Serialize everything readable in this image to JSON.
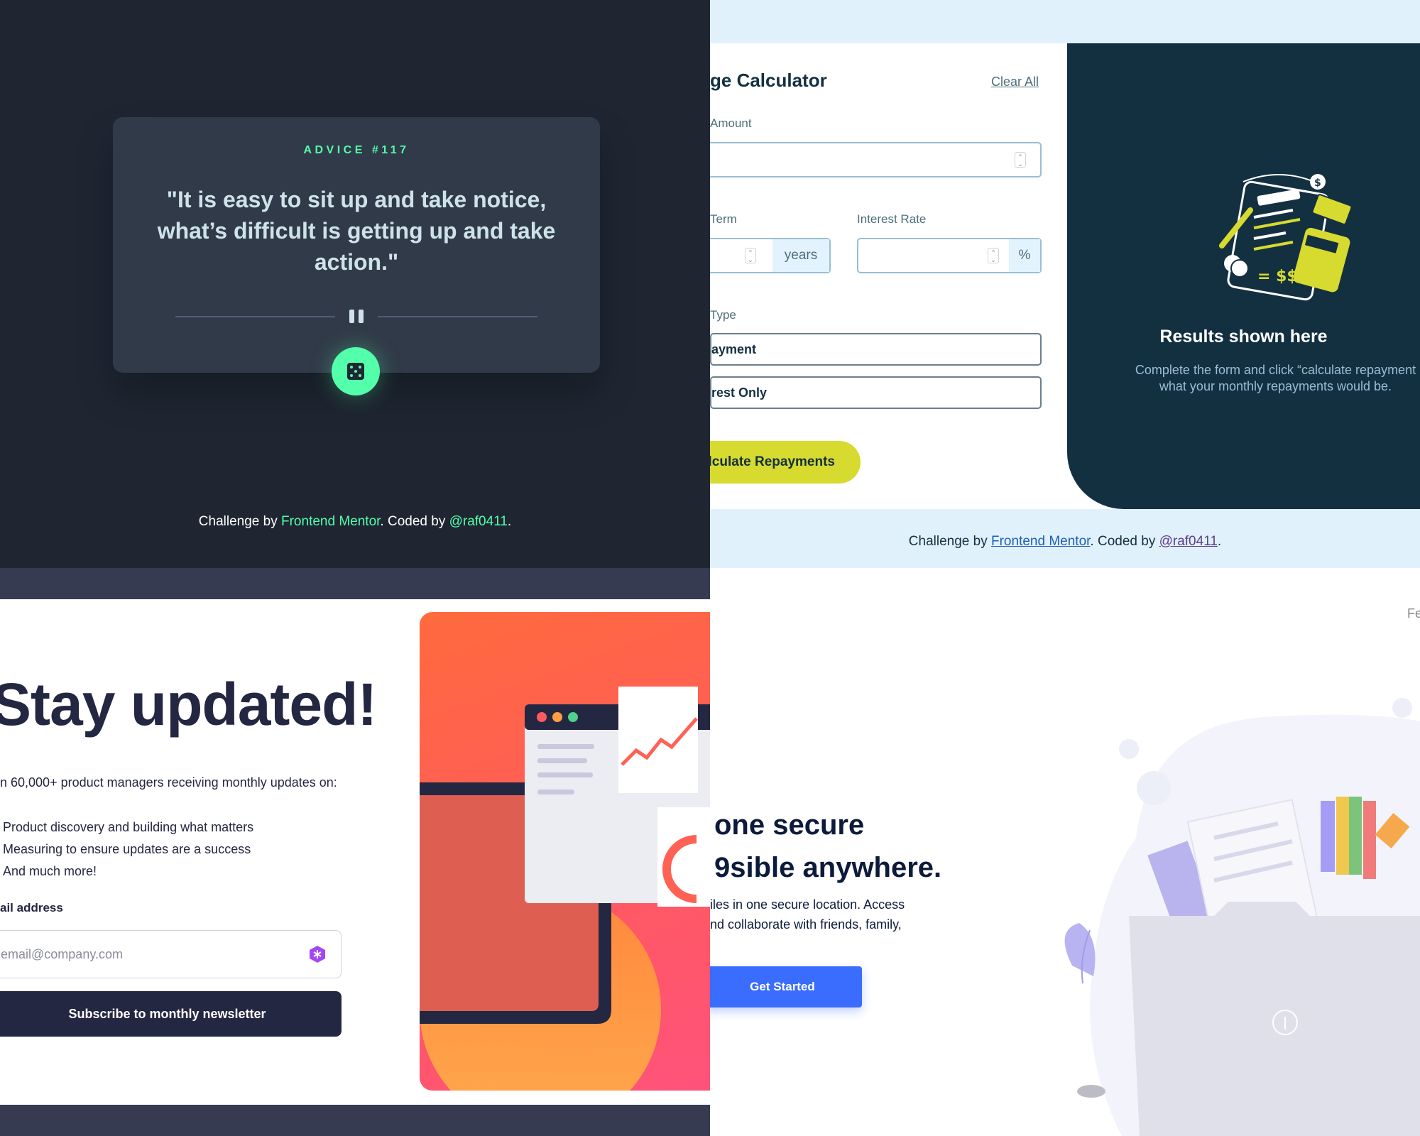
{
  "advice": {
    "id_label": "ADVICE #117",
    "quote": "\"It is easy to sit up and take notice, what’s difficult is getting up and take action.\"",
    "footer": {
      "prefix": "Challenge by ",
      "link1": "Frontend Mentor",
      "middle": ". Coded by ",
      "link2": "@raf0411",
      "suffix": "."
    },
    "colors": {
      "background": "#1f2632",
      "card": "#313a48",
      "accent": "#53ffaa"
    }
  },
  "mortgage": {
    "title": "ge Calculator",
    "clear_all": "Clear All",
    "amount_label": "Amount",
    "term_label": "Term",
    "term_unit": "years",
    "rate_label": "Interest Rate",
    "rate_unit": "%",
    "type_label": "Type",
    "type_options": [
      "ayment",
      "rest Only"
    ],
    "submit": "lculate Repayments",
    "results_title": "Results shown here",
    "results_text_line1": "Complete the form and click “calculate repayment",
    "results_text_line2": "what your monthly repayments would be.",
    "footer": {
      "prefix": "Challenge by ",
      "link1": "Frontend Mentor",
      "middle": ". Coded by ",
      "link2": "@raf0411",
      "suffix": "."
    },
    "colors": {
      "lime": "#d7da2f",
      "dark": "#133041",
      "bg": "#e1f1fc"
    }
  },
  "newsletter": {
    "title": "Stay updated!",
    "subtitle": "n 60,000+ product managers receiving monthly updates on:",
    "items": [
      "Product discovery and building what matters",
      "Measuring to ensure updates are a success",
      "And much more!"
    ],
    "email_label": "ail address",
    "email_placeholder": "email@company.com",
    "submit": "Subscribe to monthly newsletter",
    "colors": {
      "dark": "#242742",
      "tomato": "#ff6155"
    }
  },
  "fylo": {
    "nav_partial": "Fe",
    "headline_line1": "one secure",
    "headline_line2": "9sible anywhere.",
    "para_line1": "iles in one secure location. Access",
    "para_line2": "nd collaborate with friends, family,",
    "cta": "Get Started",
    "colors": {
      "button": "#3a6dfd",
      "heading": "#0c1b3a"
    }
  }
}
